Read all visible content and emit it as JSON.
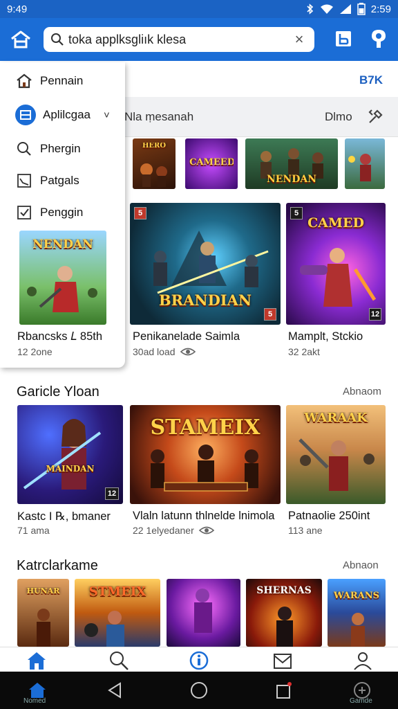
{
  "status_bar": {
    "time": "9:49",
    "clock": "2:59"
  },
  "search": {
    "query": "toka applksgliık klesa",
    "clear_glyph": "×"
  },
  "subheader": {
    "label": "B7K"
  },
  "filter_bar": {
    "text": "Nla ṃesanah",
    "filter_label": "Dlmo"
  },
  "drawer": {
    "items": [
      {
        "label": "Pennain",
        "icon": "home-icon"
      },
      {
        "label": "Aplilcgaa",
        "icon": "apps-icon",
        "selected": true
      },
      {
        "label": "Phergin",
        "icon": "search-icon"
      },
      {
        "label": "Patgals",
        "icon": "chart-icon"
      },
      {
        "label": "Penggin",
        "icon": "checkbox-icon"
      }
    ],
    "chevron": "˅"
  },
  "top_strip": [
    {
      "logo": "HERO"
    },
    {
      "logo": "CAMEED"
    },
    {
      "logo": "NENDAN"
    },
    {
      "logo": ""
    }
  ],
  "featured": [
    {
      "title": "Rbancsks 𝐿 85th",
      "sub": "12 2one",
      "logo": "NENDAN",
      "badge": ""
    },
    {
      "title": "Penikanelade Saimla",
      "sub": "30ad load",
      "logo": "BRANDIAN",
      "badge": "5",
      "badge2": "5",
      "has_icon": true
    },
    {
      "title": "Mamplt, Stckio",
      "sub": "32 2akt",
      "logo": "CAMED",
      "badge": "5",
      "badge2": "12"
    }
  ],
  "section1": {
    "title": "Garicle Yloan",
    "more": "Abnaom",
    "cards": [
      {
        "title": "Kastc I ℞, bmaner",
        "sub": "71 ama",
        "logo": "MAINDAN",
        "badge": "12"
      },
      {
        "title": "Vlaln latunn thlnelde lnimola",
        "sub": "22 1elyedaner",
        "logo": "STAMEIX",
        "has_icon": true
      },
      {
        "title": "Patnaolie 250int",
        "sub": "113 ane",
        "logo": "WARAAK"
      }
    ]
  },
  "section2": {
    "title": "Katrclarkame",
    "more": "Abnaon",
    "logos": [
      "HUNAR",
      "STMEIX",
      "",
      "SHERNAS",
      "WARANS"
    ]
  },
  "bottom_nav": [
    "home-icon",
    "search-icon",
    "info-icon",
    "mail-icon",
    "profile-icon"
  ],
  "system_bar": {
    "left_caption": "Nomed",
    "right_caption": "Gamde"
  },
  "colors": {
    "brand_blue": "#1b6dd6",
    "status_blue": "#1b63c4",
    "accent_text": "#1b5fc0"
  }
}
